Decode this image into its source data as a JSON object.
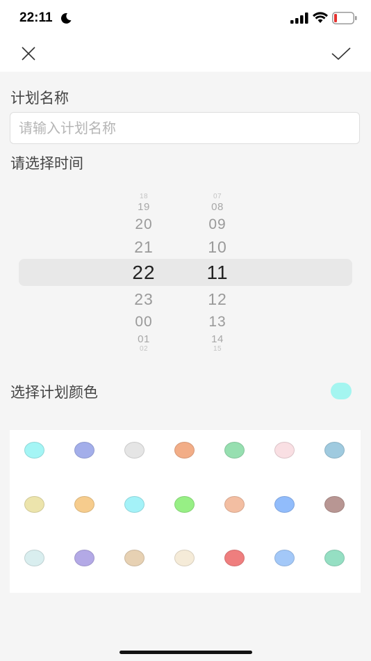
{
  "status_bar": {
    "time": "22:11"
  },
  "form": {
    "name_label": "计划名称",
    "name_placeholder": "请输入计划名称",
    "name_value": "",
    "time_label": "请选择时间",
    "color_label": "选择计划颜色"
  },
  "time_picker": {
    "hours": [
      "18",
      "19",
      "20",
      "21",
      "22",
      "23",
      "00",
      "01",
      "02"
    ],
    "minutes": [
      "07",
      "08",
      "09",
      "10",
      "11",
      "12",
      "13",
      "14",
      "15"
    ],
    "selected_hour": "22",
    "selected_minute": "11"
  },
  "selected_color": "#a4f5f0",
  "palette": [
    [
      "#a4f5f5",
      "#a3aeea",
      "#e5e5e5",
      "#f2ad87",
      "#96dfb0",
      "#f9dfe3",
      "#9fcadf"
    ],
    [
      "#ece4ac",
      "#f6cc8d",
      "#a4f2f8",
      "#97ef85",
      "#f3bea2",
      "#91bcfb",
      "#b89693"
    ],
    [
      "#d9eeef",
      "#b3a9e6",
      "#e7d1b3",
      "#f5ebd8",
      "#ef7e7e",
      "#a3c8f8",
      "#95dfc3"
    ]
  ],
  "icons": {
    "close": "close-icon",
    "confirm": "checkmark-icon",
    "moon": "moon-icon",
    "signal": "cellular-signal-icon",
    "wifi": "wifi-icon",
    "battery": "battery-low-icon"
  }
}
